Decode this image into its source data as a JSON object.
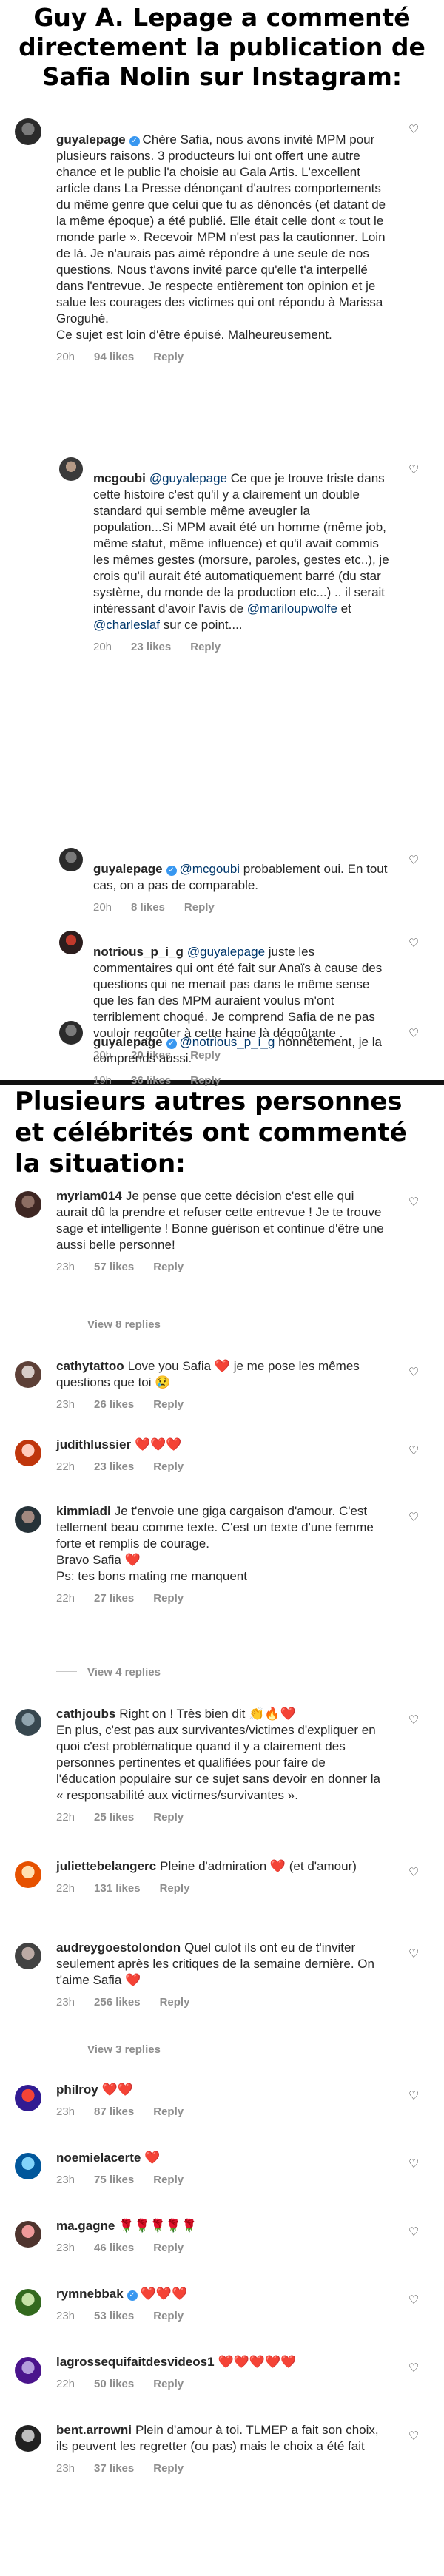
{
  "headline_1": "Guy A. Lepage a commenté directement la publication de Safia Nolin sur Instagram:",
  "headline_2": "Plusieurs autres personnes et célébrités ont commenté la situation:",
  "colors": {
    "verified": "#3897f0",
    "meta": "#8e8e8e",
    "mention": "#00376b",
    "heart_emoji": "#ed1c24"
  },
  "panel_1": {
    "comments": [
      {
        "username": "guyalepage",
        "verified": true,
        "text": "Chère Safia, nous avons invité MPM pour plusieurs raisons. 3 producteurs lui ont offert une autre chance et le public l'a choisie au Gala Artis. L'excellent article dans La Presse dénonçant d'autres comportements du même genre que celui que tu as dénoncés (et datant de la même époque) a été publié. Elle était celle dont « tout le monde parle ». Recevoir MPM n'est pas la cautionner. Loin de là. Je n'aurais pas aimé répondre à une seule de nos questions. Nous t'avons invité parce qu'elle t'a interpellé dans l'entrevue. Je respecte entièrement ton opinion et je salue les courages des victimes qui ont répondu à Marissa Groguhé.\nCe sujet est loin d'être épuisé. Malheureusement.",
        "time": "20h",
        "likes": "94 likes",
        "reply": "Reply"
      },
      {
        "username": "mcgoubi",
        "verified": false,
        "mention_prefix": "@guyalepage",
        "text": "Ce que je trouve triste dans cette histoire c'est qu'il y a clairement un double standard qui semble même aveugler la population...Si MPM avait été un homme (même job, même statut, même influence) et qu'il avait commis les mêmes gestes (morsure, paroles, gestes etc..), je crois qu'il aurait été automatiquement barré (du star système, du monde de la production etc...) .. il serait intéressant d'avoir l'avis de",
        "mention_a": "@mariloupwolfe",
        "and_word": "et",
        "mention_b": "@charleslaf",
        "text_end": "sur ce point....",
        "time": "20h",
        "likes": "23 likes",
        "reply": "Reply"
      },
      {
        "username": "guyalepage",
        "verified": true,
        "mention_prefix": "@mcgoubi",
        "text": "probablement oui. En tout cas, on a pas de comparable.",
        "time": "20h",
        "likes": "8 likes",
        "reply": "Reply"
      },
      {
        "username": "notrious_p_i_g",
        "verified": false,
        "mention_prefix": "@guyalepage",
        "text": "juste les commentaires qui ont été fait sur Anaïs à cause des questions qui ne menait pas dans le même sense que les fan des MPM auraient voulus m'ont terriblement choqué. Je comprend Safia de ne pas vouloir regoûter à cette haine là dégoûtante .",
        "time": "20h",
        "likes": "20 likes",
        "reply": "Reply"
      },
      {
        "username": "guyalepage",
        "verified": true,
        "mention_prefix": "@notrious_p_i_g",
        "text": "honnêtement, je la comprends aussi.",
        "time": "19h",
        "likes": "36 likes",
        "reply": "Reply"
      }
    ]
  },
  "panel_2": {
    "comments": [
      {
        "username": "myriam014",
        "verified": false,
        "text": "Je pense que cette décision c'est elle qui aurait dû la prendre et refuser cette entrevue ! Je te trouve sage et intelligente ! Bonne guérison et continue d'être une aussi belle personne!",
        "time": "23h",
        "likes": "57 likes",
        "reply": "Reply",
        "view_replies": "View 8 replies"
      },
      {
        "username": "cathytattoo",
        "verified": false,
        "text": "Love you Safia ❤️ je me pose les mêmes questions que toi 😢",
        "time": "23h",
        "likes": "26 likes",
        "reply": "Reply"
      },
      {
        "username": "judithlussier",
        "verified": false,
        "text": "❤️❤️❤️",
        "time": "22h",
        "likes": "23 likes",
        "reply": "Reply"
      },
      {
        "username": "kimmiadl",
        "verified": false,
        "text": "Je t'envoie une giga cargaison d'amour. C'est tellement beau comme texte. C'est un texte d'une femme forte et remplis de courage.\nBravo Safia ❤️\nPs: tes bons mating me manquent",
        "time": "22h",
        "likes": "27 likes",
        "reply": "Reply",
        "view_replies": "View 4 replies"
      },
      {
        "username": "cathjoubs",
        "verified": false,
        "text": "Right on !  Très bien dit 👏🔥❤️\nEn plus, c'est pas aux survivantes/victimes d'expliquer en quoi c'est problématique quand il y a clairement des personnes pertinentes et qualifiées pour faire de l'éducation populaire sur ce sujet sans devoir en donner la « responsabilité aux victimes/survivantes ».",
        "time": "22h",
        "likes": "25 likes",
        "reply": "Reply"
      },
      {
        "username": "juliettebelangerc",
        "verified": false,
        "text": "Pleine d'admiration ❤️ (et d'amour)",
        "time": "22h",
        "likes": "131 likes",
        "reply": "Reply"
      },
      {
        "username": "audreygoestolondon",
        "verified": false,
        "text": "Quel culot ils ont eu de t'inviter seulement après les critiques de la semaine dernière. On t'aime Safia ❤️",
        "time": "23h",
        "likes": "256 likes",
        "reply": "Reply",
        "view_replies": "View 3 replies"
      },
      {
        "username": "philroy",
        "verified": false,
        "text": "❤️❤️",
        "time": "23h",
        "likes": "87 likes",
        "reply": "Reply"
      },
      {
        "username": "noemielacerte",
        "verified": false,
        "text": "❤️",
        "time": "23h",
        "likes": "75 likes",
        "reply": "Reply"
      },
      {
        "username": "ma.gagne",
        "verified": false,
        "text": "🌹🌹🌹🌹🌹",
        "time": "23h",
        "likes": "46 likes",
        "reply": "Reply"
      },
      {
        "username": "rymnebbak",
        "verified": true,
        "text": "❤️❤️❤️",
        "time": "23h",
        "likes": "53 likes",
        "reply": "Reply"
      },
      {
        "username": "lagrossequifaitdesvideos1",
        "verified": false,
        "text": "❤️❤️❤️❤️❤️",
        "time": "22h",
        "likes": "50 likes",
        "reply": "Reply"
      },
      {
        "username": "bent.arrowni",
        "verified": false,
        "text": "Plein d'amour à toi. TLMEP a fait son choix, ils peuvent les regretter (ou pas) mais le choix a été fait",
        "time": "23h",
        "likes": "37 likes",
        "reply": "Reply"
      }
    ]
  }
}
